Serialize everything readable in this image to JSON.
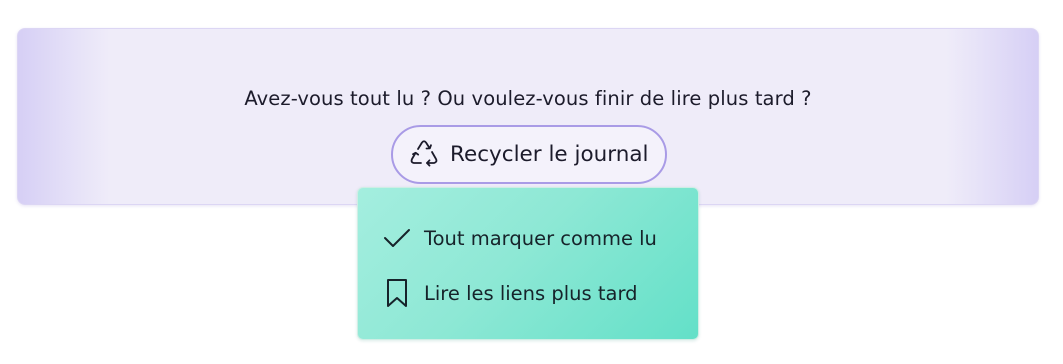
{
  "banner": {
    "question": "Avez-vous tout lu ? Ou voulez-vous finir de lire plus tard ?",
    "recycle_button": {
      "icon": "recycle-icon",
      "label": "Recycler le journal"
    }
  },
  "menu": {
    "items": [
      {
        "icon": "checkmark-icon",
        "label": "Tout marquer comme lu"
      },
      {
        "icon": "bookmark-icon",
        "label": "Lire les liens plus tard"
      }
    ]
  },
  "colors": {
    "banner_bg": "#efecf9",
    "button_border": "#a99be6",
    "menu_bg_start": "#a4eedf",
    "menu_bg_end": "#63e0c8",
    "text": "#1c1b2b"
  }
}
